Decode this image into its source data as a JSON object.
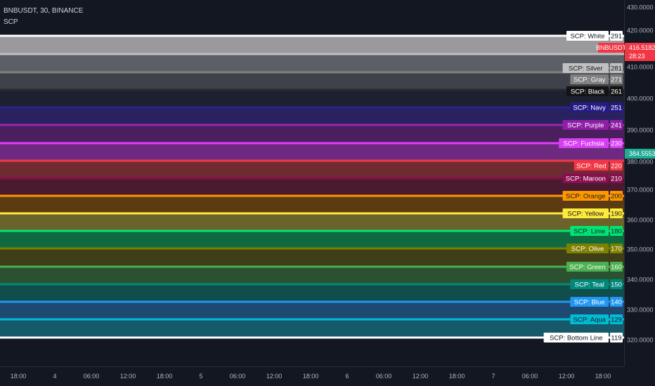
{
  "symbol_title": "BNBUSDT, 30, BINANCE",
  "indicator_name": "SCP",
  "colors": {
    "background": "#131722",
    "axis_text": "#b2b5be",
    "grid": "#2a2e39"
  },
  "price_axis": {
    "ticks": [
      "430.0000",
      "420.0000",
      "410.0000",
      "400.0000",
      "390.0000",
      "380.0000",
      "370.0000",
      "360.0000",
      "350.0000",
      "340.0000",
      "330.0000",
      "320.0000"
    ]
  },
  "time_axis": {
    "ticks": [
      "18:00",
      "4",
      "06:00",
      "12:00",
      "18:00",
      "5",
      "06:00",
      "12:00",
      "18:00",
      "6",
      "06:00",
      "12:00",
      "18:00",
      "7",
      "06:00",
      "12:00",
      "18:00"
    ]
  },
  "current_price": {
    "label": "BNBUSDT",
    "value": "416.5182",
    "countdown": "28:23",
    "color": "#f23645"
  },
  "cursor_price": {
    "value": "384.5553",
    "color": "#22ab94"
  },
  "bands": [
    {
      "name": "SCP: White",
      "value": "291",
      "line": "#ffffff",
      "fill": "#9a9a9e",
      "label_bg": "#ffffff",
      "label_fg": "#131722"
    },
    {
      "name": "SCP: Silver",
      "value": "281",
      "line": "#c0c0c0",
      "fill": "#5d5f66",
      "label_bg": "#c0c0c0",
      "label_fg": "#131722"
    },
    {
      "name": "SCP: Gray",
      "value": "271",
      "line": "#808080",
      "fill": "#3f424a",
      "label_bg": "#808080",
      "label_fg": "#ffffff"
    },
    {
      "name": "SCP: Black",
      "value": "261",
      "line": "#2a2a2a",
      "fill": "#1d2030",
      "label_bg": "#131313",
      "label_fg": "#ffffff"
    },
    {
      "name": "SCP: Navy",
      "value": "251",
      "line": "#2a238f",
      "fill": "#2a2260",
      "label_bg": "#241c86",
      "label_fg": "#ffffff"
    },
    {
      "name": "SCP: Purple",
      "value": "241",
      "line": "#9c27b0",
      "fill": "#4b1e5e",
      "label_bg": "#8e1fa6",
      "label_fg": "#ffffff"
    },
    {
      "name": "SCP: Fuchsia",
      "value": "230",
      "line": "#e040fb",
      "fill": "#6e2a80",
      "label_bg": "#d63ff0",
      "label_fg": "#ffffff"
    },
    {
      "name": "SCP: Red",
      "value": "220",
      "line": "#f23645",
      "fill": "#6e2c32",
      "label_bg": "#f23645",
      "label_fg": "#ffffff"
    },
    {
      "name": "SCP: Maroon",
      "value": "210",
      "line": "#880e4f",
      "fill": "#4a1a2e",
      "label_bg": "#880e4f",
      "label_fg": "#ffffff"
    },
    {
      "name": "SCP: Orange",
      "value": "200",
      "line": "#ff9800",
      "fill": "#5c3a12",
      "label_bg": "#ff9800",
      "label_fg": "#131722"
    },
    {
      "name": "SCP: Yellow",
      "value": "190",
      "line": "#ffeb3b",
      "fill": "#6b6329",
      "label_bg": "#ffeb3b",
      "label_fg": "#131722"
    },
    {
      "name": "SCP: Lime",
      "value": "180",
      "line": "#00e676",
      "fill": "#0f6a3f",
      "label_bg": "#00e676",
      "label_fg": "#131722"
    },
    {
      "name": "SCP: Olive",
      "value": "170",
      "line": "#808000",
      "fill": "#3e3e18",
      "label_bg": "#808000",
      "label_fg": "#ffffff"
    },
    {
      "name": "SCP: Green",
      "value": "160",
      "line": "#4caf50",
      "fill": "#2b5230",
      "label_bg": "#4caf50",
      "label_fg": "#ffffff"
    },
    {
      "name": "SCP: Teal",
      "value": "150",
      "line": "#00897b",
      "fill": "#0f4e4a",
      "label_bg": "#00897b",
      "label_fg": "#ffffff"
    },
    {
      "name": "SCP: Blue",
      "value": "140",
      "line": "#2196f3",
      "fill": "#1e4a72",
      "label_bg": "#2196f3",
      "label_fg": "#ffffff"
    },
    {
      "name": "SCP: Aqua",
      "value": "129",
      "line": "#00bcd4",
      "fill": "#16596a",
      "label_bg": "#00bcd4",
      "label_fg": "#131722"
    },
    {
      "name": "SCP: Bottom Line",
      "value": "119",
      "line": "#ffffff",
      "fill": null,
      "label_bg": "#ffffff",
      "label_fg": "#131722"
    }
  ]
}
